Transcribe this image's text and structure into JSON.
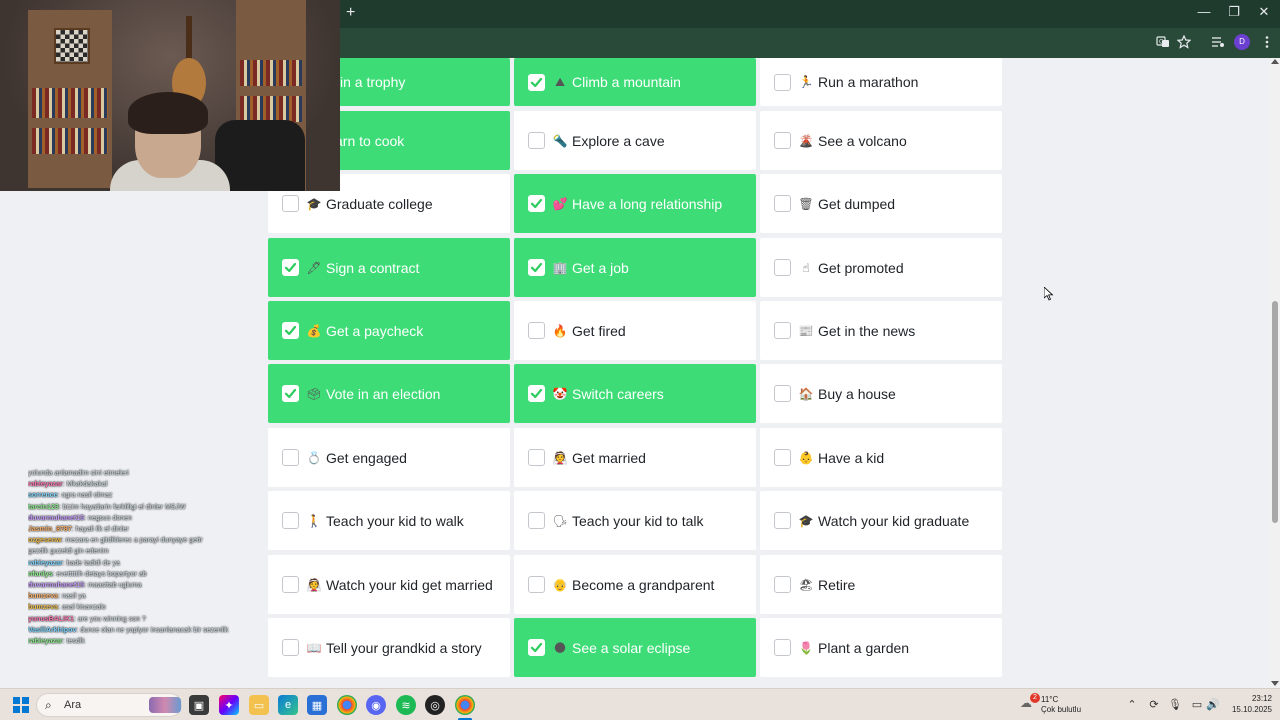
{
  "browser": {
    "new_tab_glyph": "+",
    "window_controls": [
      "—",
      "❐",
      "✕"
    ],
    "profile_initial": "D"
  },
  "grid": {
    "rows": [
      [
        {
          "label": "in a trophy",
          "emoji": "🏆",
          "checked": true
        },
        {
          "label": "Climb a mountain",
          "emoji": "⛰",
          "checked": true
        },
        {
          "label": "Run a marathon",
          "emoji": "🏃",
          "checked": false
        }
      ],
      [
        {
          "label": "arn to cook",
          "emoji": "🍳",
          "checked": true
        },
        {
          "label": "Explore a cave",
          "emoji": "🔦",
          "checked": false
        },
        {
          "label": "See a volcano",
          "emoji": "🌋",
          "checked": false
        }
      ],
      [
        {
          "label": "Graduate college",
          "emoji": "🎓",
          "checked": false
        },
        {
          "label": "Have a long relationship",
          "emoji": "💕",
          "checked": true
        },
        {
          "label": "Get dumped",
          "emoji": "🗑",
          "checked": false
        }
      ],
      [
        {
          "label": "Sign a contract",
          "emoji": "🖋",
          "checked": true
        },
        {
          "label": "Get a job",
          "emoji": "🏢",
          "checked": true
        },
        {
          "label": "Get promoted",
          "emoji": "☝",
          "checked": false
        }
      ],
      [
        {
          "label": "Get a paycheck",
          "emoji": "💰",
          "checked": true
        },
        {
          "label": "Get fired",
          "emoji": "🔥",
          "checked": false
        },
        {
          "label": "Get in the news",
          "emoji": "📰",
          "checked": false
        }
      ],
      [
        {
          "label": "Vote in an election",
          "emoji": "🗳",
          "checked": true
        },
        {
          "label": "Switch careers",
          "emoji": "🤡",
          "checked": true
        },
        {
          "label": "Buy a house",
          "emoji": "🏠",
          "checked": false
        }
      ],
      [
        {
          "label": "Get engaged",
          "emoji": "💍",
          "checked": false
        },
        {
          "label": "Get married",
          "emoji": "👰",
          "checked": false
        },
        {
          "label": "Have a kid",
          "emoji": "👶",
          "checked": false
        }
      ],
      [
        {
          "label": "Teach your kid to walk",
          "emoji": "🚶",
          "checked": false
        },
        {
          "label": "Teach your kid to talk",
          "emoji": "🗣",
          "checked": false
        },
        {
          "label": "Watch your kid graduate",
          "emoji": "🎓",
          "checked": false
        }
      ],
      [
        {
          "label": "Watch your kid get married",
          "emoji": "👰",
          "checked": false
        },
        {
          "label": "Become a grandparent",
          "emoji": "👴",
          "checked": false
        },
        {
          "label": "Retire",
          "emoji": "🏖",
          "checked": false
        }
      ],
      [
        {
          "label": "Tell your grandkid a story",
          "emoji": "📖",
          "checked": false
        },
        {
          "label": "See a solar eclipse",
          "emoji": "🌑",
          "checked": true
        },
        {
          "label": "Plant a garden",
          "emoji": "🌷",
          "checked": false
        }
      ]
    ]
  },
  "chat": [
    {
      "user": "",
      "text": "yolunda anlamadim sirri etmeleri"
    },
    {
      "user": "rabieyazar",
      "text": ": Mkakdakakal"
    },
    {
      "user": "sorrence",
      "text": ": ogra nasil olmaz"
    },
    {
      "user": "tarcin123",
      "text": ": bizim hayatlarin farkliligi el dinler MSJW"
    },
    {
      "user": "duvarmuhanet15",
      "text": ": negsus donen"
    },
    {
      "user": "Jasmin_8787",
      "text": ": hayali ilk el dinler"
    },
    {
      "user": "ozgesenw",
      "text": ": mezara en gitdiklerec a parayi dunyaye getir"
    },
    {
      "user": "",
      "text": "gezdik guzeldi gin edenim"
    },
    {
      "user": "rabieyazar",
      "text": ": bade tadidi de ya"
    },
    {
      "user": "nfanlys",
      "text": ": evetttttih detays bopartyor ab"
    },
    {
      "user": "duvarmuhanet15",
      "text": ": maasttab ugluma"
    },
    {
      "user": "bumzeva",
      "text": ": nasil ya"
    },
    {
      "user": "bumzeva",
      "text": ": asal kisanzalo"
    },
    {
      "user": "yunusBALIK1",
      "text": ": are you winning son ?"
    },
    {
      "user": "VasiliArkhipov",
      "text": ": dunce olan ne yapiyor insanlanacak bir sezenlik"
    },
    {
      "user": "rabieyazar",
      "text": ": tesdik"
    }
  ],
  "taskbar": {
    "search_placeholder": "Ara",
    "weather_temp": "11°C",
    "weather_desc": "Çok bulutlu",
    "weather_badge": "2",
    "time": "23:12",
    "date": "15.10.2025"
  },
  "colors": {
    "checked": "#3ddc77",
    "titlebar": "#1f3b2d",
    "toolbar": "#2a4a39"
  }
}
